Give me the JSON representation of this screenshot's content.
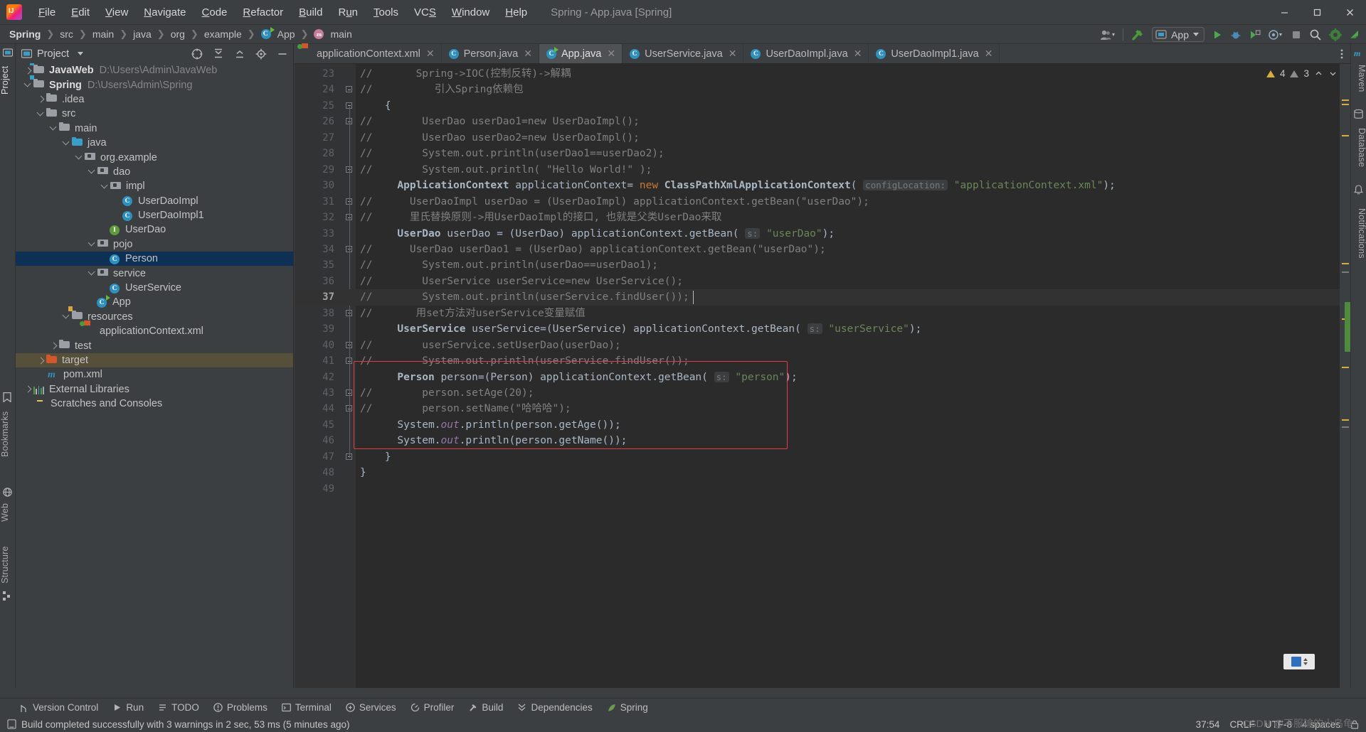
{
  "window": {
    "title": "Spring - App.java [Spring]",
    "logo_icon": "intellij-idea-logo",
    "minimize_icon": "minimize-icon",
    "maximize_icon": "maximize-icon",
    "close_icon": "close-icon"
  },
  "menu": [
    {
      "label": "File"
    },
    {
      "label": "Edit"
    },
    {
      "label": "View"
    },
    {
      "label": "Navigate"
    },
    {
      "label": "Code"
    },
    {
      "label": "Refactor"
    },
    {
      "label": "Build"
    },
    {
      "label": "Run"
    },
    {
      "label": "Tools"
    },
    {
      "label": "VCS"
    },
    {
      "label": "Window"
    },
    {
      "label": "Help"
    }
  ],
  "breadcrumbs": [
    {
      "label": "Spring",
      "bold": true,
      "icon": ""
    },
    {
      "label": "src",
      "bold": false,
      "icon": ""
    },
    {
      "label": "main",
      "bold": false,
      "icon": ""
    },
    {
      "label": "java",
      "bold": false,
      "icon": ""
    },
    {
      "label": "org",
      "bold": false,
      "icon": ""
    },
    {
      "label": "example",
      "bold": false,
      "icon": ""
    },
    {
      "label": "App",
      "bold": false,
      "icon": "class-icon"
    },
    {
      "label": "main",
      "bold": false,
      "icon": "method-icon"
    }
  ],
  "toolbar": {
    "account_icon": "user-account-icon",
    "hammer_icon": "build-hammer-icon",
    "run_config_label": "App",
    "run_config_icon": "run-config-app-icon",
    "run_icon": "run-play-icon",
    "debug_icon": "debug-bug-icon",
    "coverage_icon": "run-with-coverage-icon",
    "profile_icon": "profile-icon",
    "stop_icon": "stop-icon",
    "search_icon": "search-everywhere-icon",
    "settings_icon": "settings-gear-icon",
    "updates_icon": "updates-icon"
  },
  "left_strip": [
    {
      "label": "Project",
      "icon": "project-icon",
      "selected": true
    },
    {
      "label": "Bookmarks",
      "icon": "bookmarks-icon",
      "selected": false
    },
    {
      "label": "Web",
      "icon": "web-icon",
      "selected": false
    },
    {
      "label": "Structure",
      "icon": "structure-icon",
      "selected": false
    }
  ],
  "right_strip": [
    {
      "label": "Maven",
      "icon": "maven-icon"
    },
    {
      "label": "Database",
      "icon": "database-icon"
    },
    {
      "label": "Notifications",
      "icon": "notifications-icon"
    }
  ],
  "project_panel": {
    "title": "Project",
    "dropdown_icon": "chevron-down-icon",
    "actions": [
      {
        "icon": "select-opened-file-icon"
      },
      {
        "icon": "expand-all-icon"
      },
      {
        "icon": "collapse-all-icon"
      },
      {
        "icon": "settings-gear-icon"
      },
      {
        "icon": "hide-icon"
      }
    ],
    "tree": [
      {
        "indent": 0,
        "arrow": "right",
        "icon": "module-folder-icon",
        "label": "JavaWeb",
        "bold": true,
        "path": "D:\\Users\\Admin\\JavaWeb"
      },
      {
        "indent": 0,
        "arrow": "down",
        "icon": "module-folder-icon",
        "label": "Spring",
        "bold": true,
        "path": "D:\\Users\\Admin\\Spring"
      },
      {
        "indent": 1,
        "arrow": "right",
        "icon": "folder-icon",
        "label": ".idea",
        "bold": false,
        "path": ""
      },
      {
        "indent": 1,
        "arrow": "down",
        "icon": "folder-icon",
        "label": "src",
        "bold": false,
        "path": ""
      },
      {
        "indent": 2,
        "arrow": "down",
        "icon": "folder-icon",
        "label": "main",
        "bold": false,
        "path": ""
      },
      {
        "indent": 3,
        "arrow": "down",
        "icon": "source-folder-icon",
        "label": "java",
        "bold": false,
        "path": ""
      },
      {
        "indent": 4,
        "arrow": "down",
        "icon": "package-icon",
        "label": "org.example",
        "bold": false,
        "path": ""
      },
      {
        "indent": 5,
        "arrow": "down",
        "icon": "package-icon",
        "label": "dao",
        "bold": false,
        "path": ""
      },
      {
        "indent": 6,
        "arrow": "down",
        "icon": "package-icon",
        "label": "impl",
        "bold": false,
        "path": ""
      },
      {
        "indent": 7,
        "arrow": "none",
        "icon": "class-icon",
        "label": "UserDaoImpl",
        "bold": false,
        "path": ""
      },
      {
        "indent": 7,
        "arrow": "none",
        "icon": "class-icon",
        "label": "UserDaoImpl1",
        "bold": false,
        "path": ""
      },
      {
        "indent": 6,
        "arrow": "none",
        "icon": "interface-icon",
        "label": "UserDao",
        "bold": false,
        "path": ""
      },
      {
        "indent": 5,
        "arrow": "down",
        "icon": "package-icon",
        "label": "pojo",
        "bold": false,
        "path": ""
      },
      {
        "indent": 6,
        "arrow": "none",
        "icon": "class-icon",
        "label": "Person",
        "bold": false,
        "path": "",
        "selected": true
      },
      {
        "indent": 5,
        "arrow": "down",
        "icon": "package-icon",
        "label": "service",
        "bold": false,
        "path": ""
      },
      {
        "indent": 6,
        "arrow": "none",
        "icon": "class-icon",
        "label": "UserService",
        "bold": false,
        "path": ""
      },
      {
        "indent": 5,
        "arrow": "none",
        "icon": "runnable-class-icon",
        "label": "App",
        "bold": false,
        "path": ""
      },
      {
        "indent": 3,
        "arrow": "down",
        "icon": "resource-folder-icon",
        "label": "resources",
        "bold": false,
        "path": ""
      },
      {
        "indent": 4,
        "arrow": "none",
        "icon": "xml-file-icon",
        "label": "applicationContext.xml",
        "bold": false,
        "path": ""
      },
      {
        "indent": 2,
        "arrow": "right",
        "icon": "folder-icon",
        "label": "test",
        "bold": false,
        "path": ""
      },
      {
        "indent": 1,
        "arrow": "right",
        "icon": "excluded-folder-icon",
        "label": "target",
        "bold": false,
        "path": "",
        "highlighted": true
      },
      {
        "indent": 1,
        "arrow": "none",
        "icon": "maven-pom-icon",
        "label": "pom.xml",
        "bold": false,
        "path": ""
      },
      {
        "indent": 0,
        "arrow": "right",
        "icon": "external-libraries-icon",
        "label": "External Libraries",
        "bold": false,
        "path": ""
      },
      {
        "indent": 0,
        "arrow": "none",
        "icon": "scratches-icon",
        "label": "Scratches and Consoles",
        "bold": false,
        "path": ""
      }
    ]
  },
  "editor_tabs": [
    {
      "label": "applicationContext.xml",
      "icon": "xml-file-icon",
      "active": false
    },
    {
      "label": "Person.java",
      "icon": "class-icon",
      "active": false
    },
    {
      "label": "App.java",
      "icon": "runnable-class-icon",
      "active": true
    },
    {
      "label": "UserService.java",
      "icon": "class-icon",
      "active": false
    },
    {
      "label": "UserDaoImpl.java",
      "icon": "class-icon",
      "active": false
    },
    {
      "label": "UserDaoImpl1.java",
      "icon": "class-icon",
      "active": false
    }
  ],
  "editor_status": {
    "warning_count": "4",
    "weak_warning_count": "3",
    "warning_icon": "warning-triangle-icon",
    "weak_warning_icon": "weak-warning-icon",
    "prev_problem_icon": "chevron-up-icon",
    "next_problem_icon": "chevron-down-icon",
    "more_icon": "more-vertical-icon"
  },
  "code": {
    "current_line": 37,
    "lines": [
      {
        "n": 23,
        "html": "<span class=\"cmt\">//       Spring-&gt;IOC(控制反转)-&gt;解耦</span>",
        "fold": "none"
      },
      {
        "n": 24,
        "html": "<span class=\"cmt\">//          引入Spring依赖包</span>",
        "fold": "end"
      },
      {
        "n": 25,
        "html": "    {",
        "fold": "start"
      },
      {
        "n": 26,
        "html": "<span class=\"cmt\">//        UserDao userDao1=new UserDaoImpl();</span>",
        "fold": "start"
      },
      {
        "n": 27,
        "html": "<span class=\"cmt\">//        UserDao userDao2=new UserDaoImpl();</span>",
        "fold": "none"
      },
      {
        "n": 28,
        "html": "<span class=\"cmt\">//        System.out.println(userDao1==userDao2);</span>",
        "fold": "none"
      },
      {
        "n": 29,
        "html": "<span class=\"cmt\">//        System.out.println( \"Hello World!\" );</span>",
        "fold": "end"
      },
      {
        "n": 30,
        "html": "      <span class=\"typ bold\">ApplicationContext</span> applicationContext= <span class=\"kw\">new</span> <span class=\"typ bold\">ClassPathXmlApplicationContext</span>( <span class=\"hint\">configLocation:</span> <span class=\"str\">\"applicationContext.xml\"</span>);",
        "fold": "none"
      },
      {
        "n": 31,
        "html": "<span class=\"cmt\">//      UserDaoImpl userDao = (UserDaoImpl) applicationContext.getBean(\"userDao\");</span>",
        "fold": "endstart"
      },
      {
        "n": 32,
        "html": "<span class=\"cmt\">//      里氏替换原则-&gt;用UserDaoImpl的接口, 也就是父类UserDao来取</span>",
        "fold": "end"
      },
      {
        "n": 33,
        "html": "      <span class=\"typ bold\">UserDao</span> userDao = (UserDao) applicationContext.getBean( <span class=\"hint\">s:</span> <span class=\"str\">\"userDao\"</span>);",
        "fold": "none"
      },
      {
        "n": 34,
        "html": "<span class=\"cmt\">//      UserDao userDao1 = (UserDao) applicationContext.getBean(\"userDao\");</span>",
        "fold": "end"
      },
      {
        "n": 35,
        "html": "<span class=\"cmt\">//        System.out.println(userDao==userDao1);</span>",
        "fold": "none"
      },
      {
        "n": 36,
        "html": "<span class=\"cmt\">//        UserService userService=new UserService();</span>",
        "fold": "none"
      },
      {
        "n": 37,
        "html": "<span class=\"cmt\">//        System.out.println(userService.findUser());</span>",
        "fold": "none"
      },
      {
        "n": 38,
        "html": "<span class=\"cmt\">//       用set方法对userService变量赋值</span>",
        "fold": "end"
      },
      {
        "n": 39,
        "html": "      <span class=\"typ bold\">UserService</span> userService=(UserService) applicationContext.getBean( <span class=\"hint\">s:</span> <span class=\"str\">\"userService\"</span>);",
        "fold": "none"
      },
      {
        "n": 40,
        "html": "<span class=\"cmt\">//        userService.setUserDao(userDao);</span>",
        "fold": "start"
      },
      {
        "n": 41,
        "html": "<span class=\"cmt\">//        System.out.println(userService.findUser());</span>",
        "fold": "end"
      },
      {
        "n": 42,
        "html": "      <span class=\"typ bold\">Person</span> person=(Person) applicationContext.getBean( <span class=\"hint\">s:</span> <span class=\"str\">\"person\"</span>);",
        "fold": "none"
      },
      {
        "n": 43,
        "html": "<span class=\"cmt\">//        person.setAge(20);</span>",
        "fold": "start"
      },
      {
        "n": 44,
        "html": "<span class=\"cmt\">//        person.setName(\"哈哈哈\");</span>",
        "fold": "end"
      },
      {
        "n": 45,
        "html": "      System.<span class=\"fld\">out</span>.println(person.getAge());",
        "fold": "none"
      },
      {
        "n": 46,
        "html": "      System.<span class=\"fld\">out</span>.println(person.getName());",
        "fold": "none"
      },
      {
        "n": 47,
        "html": "    }",
        "fold": "end"
      },
      {
        "n": 48,
        "html": "}",
        "fold": "none"
      },
      {
        "n": 49,
        "html": "",
        "fold": "none"
      }
    ]
  },
  "bottom_bar": [
    {
      "label": "Version Control",
      "icon": "version-control-icon"
    },
    {
      "label": "Run",
      "icon": "run-play-icon"
    },
    {
      "label": "TODO",
      "icon": "todo-icon"
    },
    {
      "label": "Problems",
      "icon": "problems-icon"
    },
    {
      "label": "Terminal",
      "icon": "terminal-icon"
    },
    {
      "label": "Services",
      "icon": "services-icon"
    },
    {
      "label": "Profiler",
      "icon": "profiler-icon"
    },
    {
      "label": "Build",
      "icon": "build-hammer-icon"
    },
    {
      "label": "Dependencies",
      "icon": "dependencies-icon"
    },
    {
      "label": "Spring",
      "icon": "spring-leaf-icon"
    }
  ],
  "status": {
    "message": "Build completed successfully with 3 warnings in 2 sec, 53 ms (5 minutes ago)",
    "message_icon": "build-status-icon",
    "caret_position": "37:54",
    "line_separator": "CRLF",
    "encoding": "UTF-8",
    "indent": "4 spaces",
    "lock_icon": "read-only-lock-icon",
    "watermark": "CSDN @不服输的小乌龟"
  },
  "colors": {
    "bg_panel": "#3c3f41",
    "bg_editor": "#2b2b2b",
    "bg_gutter": "#313335",
    "accent_blue": "#2f8fbd",
    "selection": "#0d3054",
    "excluded": "#56503a",
    "comment": "#808080",
    "keyword": "#cc7832",
    "string": "#6a8759",
    "redbox": "#e03e3e"
  }
}
